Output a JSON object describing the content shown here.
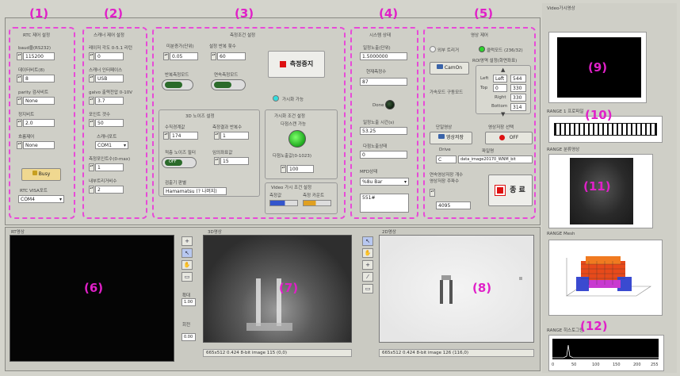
{
  "numbers": [
    "(1)",
    "(2)",
    "(3)",
    "(4)",
    "(5)",
    "(6)",
    "(7)",
    "(8)",
    "(9)",
    "(10)",
    "(11)",
    "(12)"
  ],
  "panel1": {
    "title": "RTC 제어 설정",
    "f1_label": "baud율(RS232)",
    "f1_value": "115200",
    "f2_label": "데이터비트(8)",
    "f2_value": "8",
    "f3_label": "parity 검사비트",
    "f3_value": "None",
    "f4_label": "정지비트",
    "f4_value": "2.0",
    "f5_label": "흐름제어",
    "f5_value": "None",
    "btn": "Busy",
    "port_label": "RTC VISA포트",
    "port_value": "COM4"
  },
  "panel2": {
    "title": "스캐너 제어 설정",
    "f1_label": "레이저 각도 0-5.1 리턴",
    "f1_value": "0",
    "f2_label": "스캐너 인터페이스",
    "f2_value": "USB",
    "f3_label": "galvo 출력전압 0-10V",
    "f3_value": "3.7",
    "f4_label": "포인트 갯수",
    "f4_value": "50",
    "f5_label": "스캐너포트",
    "f5_value": "COM1",
    "f6_label": "측정포인트수(0-max)",
    "f6_value": "1",
    "f7_label": "내부트리거비수",
    "f7_value": "2"
  },
  "panel3": {
    "title": "측정조건 설정",
    "f1_label": "미분증가(단위)",
    "f1_value": "0.05",
    "f2_label": "설정 반복 횟수",
    "f2_value": "60",
    "sw1_label": "반복측정모드",
    "sw2_label": "연속측정모드",
    "measure_btn": "측정중지",
    "live_label": "가시화 가능",
    "sub_title": "3D 노이즈 설정",
    "f3_label": "수직경계값",
    "f3_value": "174",
    "f4_label": "측정결과 반복수",
    "f4_value": "1",
    "sw3_label": "적층 노이즈 필터",
    "sw3_value": "OFF",
    "f5_label": "임의좌표값",
    "f5_value": "15",
    "grp2_title": "가시화 조건 설정",
    "grp2_sub": "다점스캔 가능",
    "grp2_f_label": "다점노출값(0-1023)",
    "grp2_f_value": "100",
    "path_label": "검출기 판별",
    "path_value": "Hamamatsu (? 나머지)",
    "grp3_title": "Video 가시 조건 설정",
    "grp3_a": "측정값",
    "grp3_b": "측정 카운트"
  },
  "panel4": {
    "title": "시스템 상태",
    "f1_label": "일정노출(단위)",
    "f1_value": "1.5000000",
    "f2_label": "현재측정수",
    "f2_value": "87",
    "led_label": "Done",
    "f3_label": "일정노출 시간(s)",
    "f3_value": "53.25",
    "f4_label": "다점노출상태",
    "f4_value": "0",
    "f5_label": "MFD상태",
    "sel_value": "%8u Bar",
    "msg_value": "551#"
  },
  "panel5": {
    "title": "영상 제어",
    "opt1": "외부 트리거",
    "opt2": "클럭모드 (236/32)",
    "cam_btn": "CamOn",
    "roi_title": "ROI영역 설정(화면좌표)",
    "roi_left_label": "Left",
    "roi_left_value": "Left",
    "roi_top_label": "Top",
    "roi_top_value": "0",
    "roi_right_label": "Right",
    "roi_right_value": "330",
    "roi_bottom_label": "Bottom",
    "roi_bottom_value": "314",
    "roi_w": "544",
    "roi_h": "330",
    "mode_label": "가속모드 구동모드",
    "snap_label": "단일영상",
    "save_label": "영상저장 선택",
    "snap_btn": "영상저장",
    "save_btn": "OFF",
    "drive_label": "Drive",
    "drive_value": "C",
    "file_label": "파일명",
    "file_value": "data_image20170_WNM_bit",
    "cap_label": "연속영상저장 개수",
    "cap_label2": "영상저장 주파수",
    "cap_value": "4095",
    "stop_btn": "종 료"
  },
  "view6": {
    "title": "RT영상"
  },
  "view7": {
    "title": "3D영상",
    "status": "665x512 0.424 8-bit image 115    (0,0)"
  },
  "view8": {
    "title": "2D영상",
    "status": "665x512 0.424 8-bit image 126    (116,0)"
  },
  "zoom": {
    "label_a": "확대",
    "val_a": "1.00",
    "label_b": "회전",
    "val_b": "0.00"
  },
  "right": {
    "r9_title": "Video가시영상",
    "r10_title": "RANGE 1 프로파일",
    "r11_title": "RANGE 분류영상",
    "r_mesh_title": "RANGE Mesh",
    "r12_title": "RANGE 히스토그램",
    "hist_ticks": [
      "0",
      "50",
      "100",
      "150",
      "200",
      "255"
    ]
  },
  "colors": {
    "highlight": "#e020c8",
    "panel_bg": "#cfcfc7",
    "led_green": "#33cc33",
    "stop_red": "#dd1111"
  }
}
